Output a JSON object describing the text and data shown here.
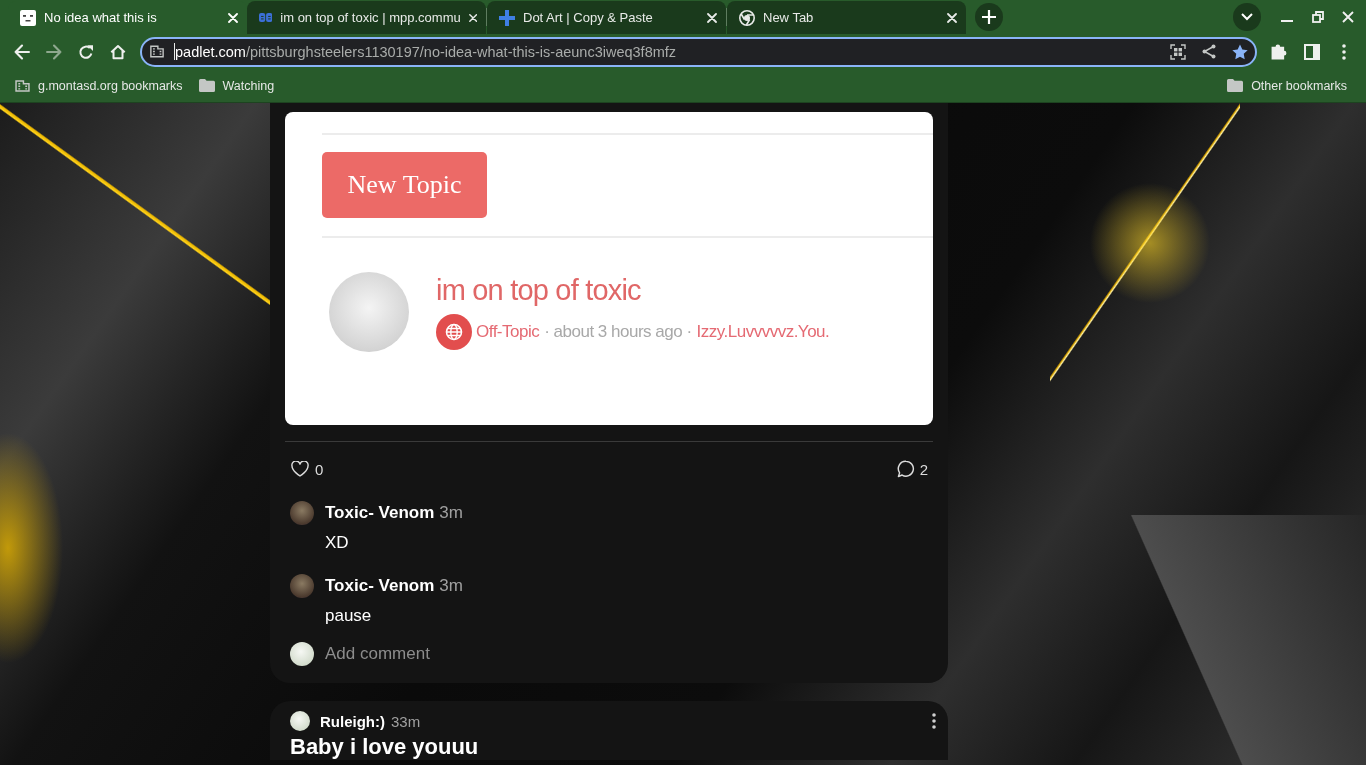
{
  "browser": {
    "tabs": [
      {
        "title": "No idea what this is",
        "selected": true
      },
      {
        "title": "im on top of toxic | mpp.commu",
        "selected": false
      },
      {
        "title": "Dot Art | Copy & Paste",
        "selected": false
      },
      {
        "title": "New Tab",
        "selected": false
      }
    ],
    "nav_buttons": [
      {
        "kind": "back",
        "disabled": false
      },
      {
        "kind": "forward",
        "disabled": true
      },
      {
        "kind": "reload",
        "disabled": false
      },
      {
        "kind": "home",
        "disabled": false
      }
    ],
    "address_bar": {
      "domain": "padlet.com",
      "path": "/pittsburghsteelers1130197/no-idea-what-this-is-aeunc3iweq3f8mfz",
      "bookmarked": true
    },
    "bookmarks": [
      {
        "label": "g.montasd.org bookmarks",
        "kind": "apps"
      },
      {
        "label": "Watching",
        "kind": "folder"
      }
    ],
    "other_bookmarks": {
      "label": "Other bookmarks"
    }
  },
  "post": {
    "attachment": {
      "button": "New Topic",
      "topic_title": "im on top of toxic",
      "category": "Off-Topic",
      "meta": "· about 3 hours ago ·",
      "author": "Izzy.Luvvvvvz.You."
    },
    "likes": "0",
    "comment_count": "2",
    "comments": [
      {
        "author": "Toxic- Venom",
        "time": "3m",
        "text": "XD"
      },
      {
        "author": "Toxic- Venom",
        "time": "3m",
        "text": "pause"
      }
    ],
    "add_comment": {
      "placeholder": "Add comment"
    }
  },
  "next_post": {
    "author": "Ruleigh:)",
    "time": "33m",
    "title": "Baby i love youuu"
  }
}
